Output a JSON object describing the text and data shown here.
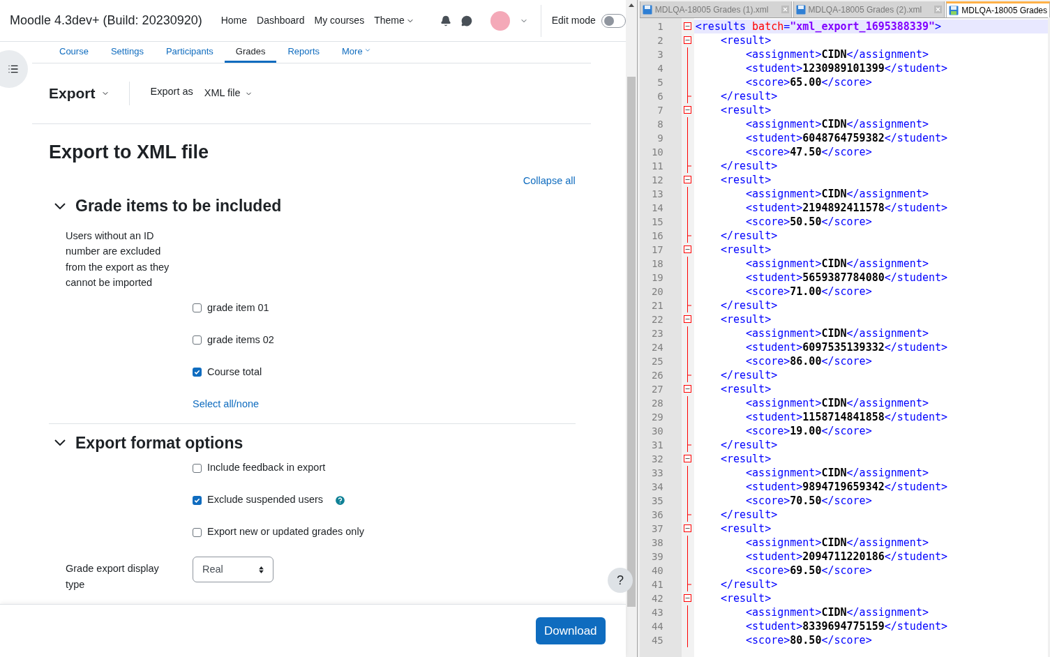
{
  "header": {
    "site_name": "Moodle 4.3dev+ (Build: 20230920)",
    "nav": [
      {
        "label": "Home",
        "dropdown": false
      },
      {
        "label": "Dashboard",
        "dropdown": false
      },
      {
        "label": "My courses",
        "dropdown": false
      },
      {
        "label": "Theme",
        "dropdown": true
      }
    ],
    "edit_mode": {
      "label": "Edit mode",
      "on": false
    }
  },
  "secondary_nav": [
    {
      "label": "Course",
      "selected": false,
      "dropdown": false
    },
    {
      "label": "Settings",
      "selected": false,
      "dropdown": false
    },
    {
      "label": "Participants",
      "selected": false,
      "dropdown": false
    },
    {
      "label": "Grades",
      "selected": true,
      "dropdown": false
    },
    {
      "label": "Reports",
      "selected": false,
      "dropdown": false
    },
    {
      "label": "More",
      "selected": false,
      "dropdown": true
    }
  ],
  "action_bar": {
    "menu": "Export",
    "export_as_label": "Export as",
    "export_as_value": "XML file"
  },
  "page_title": "Export to XML file",
  "collapse_all": "Collapse all",
  "sections": [
    {
      "title": "Grade items to be included",
      "expanded": true,
      "note": "Users without an ID number are excluded from the export as they cannot be imported",
      "items": [
        {
          "label": "grade item 01",
          "checked": false,
          "help": false
        },
        {
          "label": "grade items 02",
          "checked": false,
          "help": false
        },
        {
          "label": "Course total",
          "checked": true,
          "help": false
        }
      ],
      "link": "Select all/none"
    },
    {
      "title": "Export format options",
      "expanded": true,
      "items": [
        {
          "label": "Include feedback in export",
          "checked": false,
          "help": false
        },
        {
          "label": "Exclude suspended users",
          "checked": true,
          "help": true
        },
        {
          "label": "Export new or updated grades only",
          "checked": false,
          "help": false
        }
      ],
      "select": {
        "label": "Grade export display type",
        "value": "Real"
      }
    }
  ],
  "download_button": "Download",
  "help_button": "?",
  "editor": {
    "tabs": [
      {
        "label": "MDLQA-18005 Grades (1).xml",
        "selected": false
      },
      {
        "label": "MDLQA-18005 Grades (2).xml",
        "selected": false
      },
      {
        "label": "MDLQA-18005 Grades",
        "selected": true
      }
    ],
    "lines": [
      {
        "n": "1",
        "kind": "fold_start",
        "tokens": [
          {
            "kind": "tag",
            "text": "<results "
          },
          {
            "kind": "attr",
            "text": "batch"
          },
          {
            "kind": "tag",
            "text": "="
          },
          {
            "kind": "value",
            "text": "\"xml_export_1695388339\""
          },
          {
            "kind": "tag",
            "text": ">"
          }
        ]
      },
      {
        "n": "2",
        "kind": "fold_start",
        "tokens": [
          {
            "kind": "tag",
            "text": "    <result>"
          }
        ]
      },
      {
        "n": "3",
        "kind": "fold_body",
        "tokens": [
          {
            "kind": "tag",
            "text": "        <assignment>"
          },
          {
            "kind": "text",
            "text": "CIDN"
          },
          {
            "kind": "tag",
            "text": "</assignment>"
          }
        ]
      },
      {
        "n": "4",
        "kind": "fold_body",
        "tokens": [
          {
            "kind": "tag",
            "text": "        <student>"
          },
          {
            "kind": "text",
            "text": "1230989101399"
          },
          {
            "kind": "tag",
            "text": "</student>"
          }
        ]
      },
      {
        "n": "5",
        "kind": "fold_body",
        "tokens": [
          {
            "kind": "tag",
            "text": "        <score>"
          },
          {
            "kind": "text",
            "text": "65.00"
          },
          {
            "kind": "tag",
            "text": "</score>"
          }
        ]
      },
      {
        "n": "6",
        "kind": "fold_end",
        "tokens": [
          {
            "kind": "tag",
            "text": "    </result>"
          }
        ]
      },
      {
        "n": "7",
        "kind": "fold_start",
        "tokens": [
          {
            "kind": "tag",
            "text": "    <result>"
          }
        ]
      },
      {
        "n": "8",
        "kind": "fold_body",
        "tokens": [
          {
            "kind": "tag",
            "text": "        <assignment>"
          },
          {
            "kind": "text",
            "text": "CIDN"
          },
          {
            "kind": "tag",
            "text": "</assignment>"
          }
        ]
      },
      {
        "n": "9",
        "kind": "fold_body",
        "tokens": [
          {
            "kind": "tag",
            "text": "        <student>"
          },
          {
            "kind": "text",
            "text": "6048764759382"
          },
          {
            "kind": "tag",
            "text": "</student>"
          }
        ]
      },
      {
        "n": "10",
        "kind": "fold_body",
        "tokens": [
          {
            "kind": "tag",
            "text": "        <score>"
          },
          {
            "kind": "text",
            "text": "47.50"
          },
          {
            "kind": "tag",
            "text": "</score>"
          }
        ]
      },
      {
        "n": "11",
        "kind": "fold_end",
        "tokens": [
          {
            "kind": "tag",
            "text": "    </result>"
          }
        ]
      },
      {
        "n": "12",
        "kind": "fold_start",
        "tokens": [
          {
            "kind": "tag",
            "text": "    <result>"
          }
        ]
      },
      {
        "n": "13",
        "kind": "fold_body",
        "tokens": [
          {
            "kind": "tag",
            "text": "        <assignment>"
          },
          {
            "kind": "text",
            "text": "CIDN"
          },
          {
            "kind": "tag",
            "text": "</assignment>"
          }
        ]
      },
      {
        "n": "14",
        "kind": "fold_body",
        "tokens": [
          {
            "kind": "tag",
            "text": "        <student>"
          },
          {
            "kind": "text",
            "text": "2194892411578"
          },
          {
            "kind": "tag",
            "text": "</student>"
          }
        ]
      },
      {
        "n": "15",
        "kind": "fold_body",
        "tokens": [
          {
            "kind": "tag",
            "text": "        <score>"
          },
          {
            "kind": "text",
            "text": "50.50"
          },
          {
            "kind": "tag",
            "text": "</score>"
          }
        ]
      },
      {
        "n": "16",
        "kind": "fold_end",
        "tokens": [
          {
            "kind": "tag",
            "text": "    </result>"
          }
        ]
      },
      {
        "n": "17",
        "kind": "fold_start",
        "tokens": [
          {
            "kind": "tag",
            "text": "    <result>"
          }
        ]
      },
      {
        "n": "18",
        "kind": "fold_body",
        "tokens": [
          {
            "kind": "tag",
            "text": "        <assignment>"
          },
          {
            "kind": "text",
            "text": "CIDN"
          },
          {
            "kind": "tag",
            "text": "</assignment>"
          }
        ]
      },
      {
        "n": "19",
        "kind": "fold_body",
        "tokens": [
          {
            "kind": "tag",
            "text": "        <student>"
          },
          {
            "kind": "text",
            "text": "5659387784080"
          },
          {
            "kind": "tag",
            "text": "</student>"
          }
        ]
      },
      {
        "n": "20",
        "kind": "fold_body",
        "tokens": [
          {
            "kind": "tag",
            "text": "        <score>"
          },
          {
            "kind": "text",
            "text": "71.00"
          },
          {
            "kind": "tag",
            "text": "</score>"
          }
        ]
      },
      {
        "n": "21",
        "kind": "fold_end",
        "tokens": [
          {
            "kind": "tag",
            "text": "    </result>"
          }
        ]
      },
      {
        "n": "22",
        "kind": "fold_start",
        "tokens": [
          {
            "kind": "tag",
            "text": "    <result>"
          }
        ]
      },
      {
        "n": "23",
        "kind": "fold_body",
        "tokens": [
          {
            "kind": "tag",
            "text": "        <assignment>"
          },
          {
            "kind": "text",
            "text": "CIDN"
          },
          {
            "kind": "tag",
            "text": "</assignment>"
          }
        ]
      },
      {
        "n": "24",
        "kind": "fold_body",
        "tokens": [
          {
            "kind": "tag",
            "text": "        <student>"
          },
          {
            "kind": "text",
            "text": "6097535139332"
          },
          {
            "kind": "tag",
            "text": "</student>"
          }
        ]
      },
      {
        "n": "25",
        "kind": "fold_body",
        "tokens": [
          {
            "kind": "tag",
            "text": "        <score>"
          },
          {
            "kind": "text",
            "text": "86.00"
          },
          {
            "kind": "tag",
            "text": "</score>"
          }
        ]
      },
      {
        "n": "26",
        "kind": "fold_end",
        "tokens": [
          {
            "kind": "tag",
            "text": "    </result>"
          }
        ]
      },
      {
        "n": "27",
        "kind": "fold_start",
        "tokens": [
          {
            "kind": "tag",
            "text": "    <result>"
          }
        ]
      },
      {
        "n": "28",
        "kind": "fold_body",
        "tokens": [
          {
            "kind": "tag",
            "text": "        <assignment>"
          },
          {
            "kind": "text",
            "text": "CIDN"
          },
          {
            "kind": "tag",
            "text": "</assignment>"
          }
        ]
      },
      {
        "n": "29",
        "kind": "fold_body",
        "tokens": [
          {
            "kind": "tag",
            "text": "        <student>"
          },
          {
            "kind": "text",
            "text": "1158714841858"
          },
          {
            "kind": "tag",
            "text": "</student>"
          }
        ]
      },
      {
        "n": "30",
        "kind": "fold_body",
        "tokens": [
          {
            "kind": "tag",
            "text": "        <score>"
          },
          {
            "kind": "text",
            "text": "19.00"
          },
          {
            "kind": "tag",
            "text": "</score>"
          }
        ]
      },
      {
        "n": "31",
        "kind": "fold_end",
        "tokens": [
          {
            "kind": "tag",
            "text": "    </result>"
          }
        ]
      },
      {
        "n": "32",
        "kind": "fold_start",
        "tokens": [
          {
            "kind": "tag",
            "text": "    <result>"
          }
        ]
      },
      {
        "n": "33",
        "kind": "fold_body",
        "tokens": [
          {
            "kind": "tag",
            "text": "        <assignment>"
          },
          {
            "kind": "text",
            "text": "CIDN"
          },
          {
            "kind": "tag",
            "text": "</assignment>"
          }
        ]
      },
      {
        "n": "34",
        "kind": "fold_body",
        "tokens": [
          {
            "kind": "tag",
            "text": "        <student>"
          },
          {
            "kind": "text",
            "text": "9894719659342"
          },
          {
            "kind": "tag",
            "text": "</student>"
          }
        ]
      },
      {
        "n": "35",
        "kind": "fold_body",
        "tokens": [
          {
            "kind": "tag",
            "text": "        <score>"
          },
          {
            "kind": "text",
            "text": "70.50"
          },
          {
            "kind": "tag",
            "text": "</score>"
          }
        ]
      },
      {
        "n": "36",
        "kind": "fold_end",
        "tokens": [
          {
            "kind": "tag",
            "text": "    </result>"
          }
        ]
      },
      {
        "n": "37",
        "kind": "fold_start",
        "tokens": [
          {
            "kind": "tag",
            "text": "    <result>"
          }
        ]
      },
      {
        "n": "38",
        "kind": "fold_body",
        "tokens": [
          {
            "kind": "tag",
            "text": "        <assignment>"
          },
          {
            "kind": "text",
            "text": "CIDN"
          },
          {
            "kind": "tag",
            "text": "</assignment>"
          }
        ]
      },
      {
        "n": "39",
        "kind": "fold_body",
        "tokens": [
          {
            "kind": "tag",
            "text": "        <student>"
          },
          {
            "kind": "text",
            "text": "2094711220186"
          },
          {
            "kind": "tag",
            "text": "</student>"
          }
        ]
      },
      {
        "n": "40",
        "kind": "fold_body",
        "tokens": [
          {
            "kind": "tag",
            "text": "        <score>"
          },
          {
            "kind": "text",
            "text": "69.50"
          },
          {
            "kind": "tag",
            "text": "</score>"
          }
        ]
      },
      {
        "n": "41",
        "kind": "fold_end",
        "tokens": [
          {
            "kind": "tag",
            "text": "    </result>"
          }
        ]
      },
      {
        "n": "42",
        "kind": "fold_start",
        "tokens": [
          {
            "kind": "tag",
            "text": "    <result>"
          }
        ]
      },
      {
        "n": "43",
        "kind": "fold_body",
        "tokens": [
          {
            "kind": "tag",
            "text": "        <assignment>"
          },
          {
            "kind": "text",
            "text": "CIDN"
          },
          {
            "kind": "tag",
            "text": "</assignment>"
          }
        ]
      },
      {
        "n": "44",
        "kind": "fold_body",
        "tokens": [
          {
            "kind": "tag",
            "text": "        <student>"
          },
          {
            "kind": "text",
            "text": "8339694775159"
          },
          {
            "kind": "tag",
            "text": "</student>"
          }
        ]
      },
      {
        "n": "45",
        "kind": "fold_body",
        "tokens": [
          {
            "kind": "tag",
            "text": "        <score>"
          },
          {
            "kind": "text",
            "text": "80.50"
          },
          {
            "kind": "tag",
            "text": "</score>"
          }
        ]
      }
    ]
  }
}
